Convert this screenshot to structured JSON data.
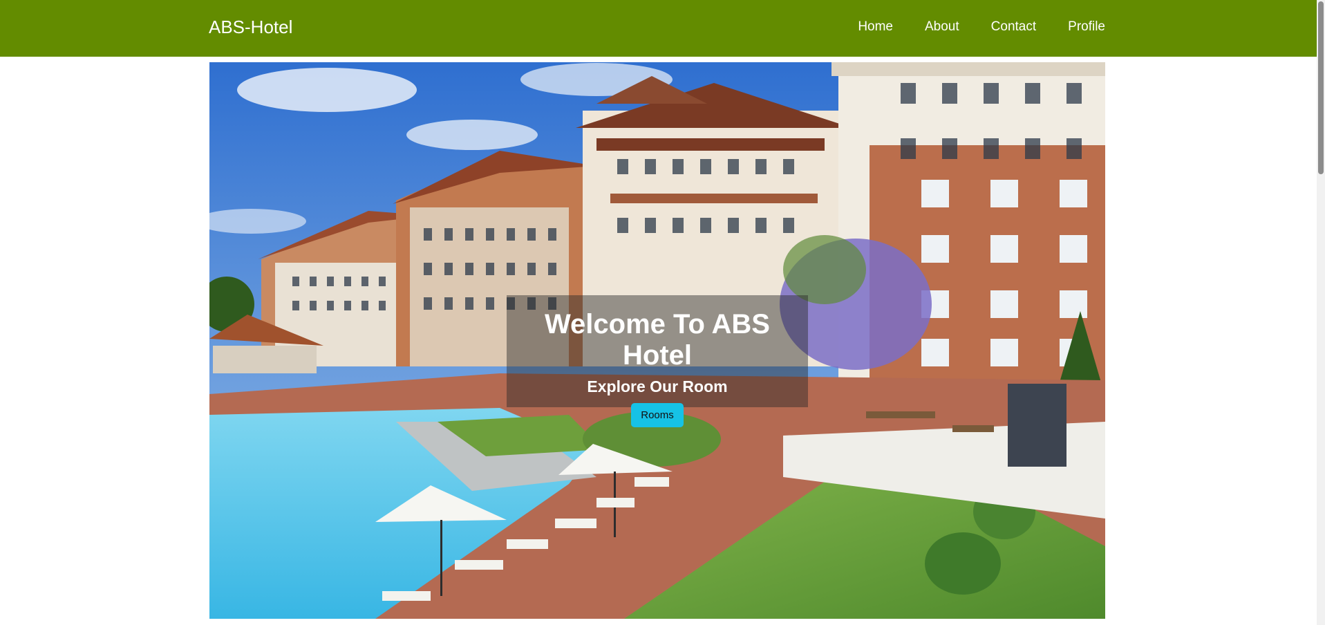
{
  "navbar": {
    "brand": "ABS-Hotel",
    "links": [
      {
        "label": "Home"
      },
      {
        "label": "About"
      },
      {
        "label": "Contact"
      },
      {
        "label": "Profile"
      }
    ],
    "background_color": "#638c00"
  },
  "hero": {
    "title": "Welcome To ABS Hotel",
    "subtitle": "Explore Our Room",
    "button_label": "Rooms",
    "button_color": "#16c2e6",
    "image_description_icon": "hotel-photo"
  }
}
